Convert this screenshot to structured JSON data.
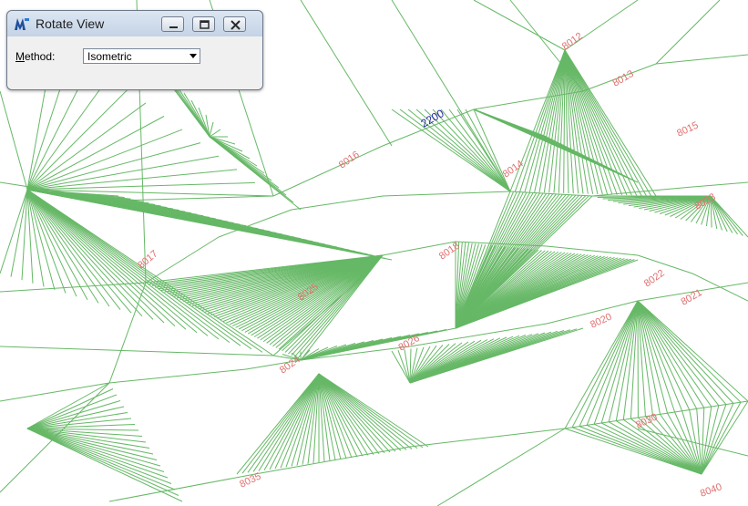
{
  "window": {
    "title": "Rotate View",
    "icon": "microstation-icon",
    "controls": [
      "minimize-icon",
      "restore-icon",
      "close-icon"
    ]
  },
  "method": {
    "label_prefix": "",
    "label_underlined": "M",
    "label_rest": "ethod:",
    "selected": "Isometric"
  },
  "drawing": {
    "line_color": "#66b866",
    "label_color": "#e07070",
    "highlight_color": "#2a2aa8",
    "point_labels": [
      "8012",
      "8013",
      "8014",
      "8015",
      "8016",
      "8017",
      "8018",
      "8020",
      "8021",
      "8022",
      "8023",
      "8024",
      "8025",
      "8026",
      "8030",
      "8035",
      "8040"
    ],
    "highlight_label": "2200"
  }
}
